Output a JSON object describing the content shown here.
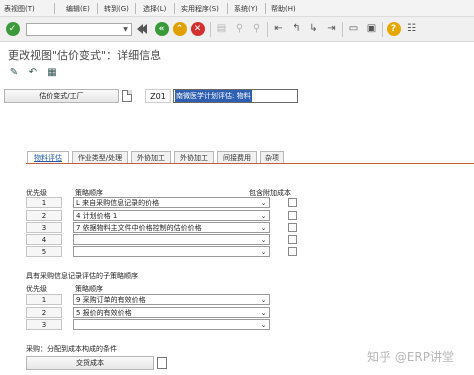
{
  "menu": [
    "表视图(T)",
    "编辑(E)",
    "转到(G)",
    "选择(L)",
    "实用程序(S)",
    "系统(Y)",
    "帮助(H)"
  ],
  "toolbar": {
    "command_value": "",
    "icons": [
      "check-icon",
      "dropdown-arrow",
      "save-icon",
      "back-icon",
      "exit-icon",
      "cancel-icon",
      "print-icon",
      "find-icon",
      "find-next-icon",
      "first-page-icon",
      "previous-page-icon",
      "next-page-icon",
      "last-page-icon",
      "new-session-icon",
      "shortcut-icon",
      "help-icon",
      "customize-icon"
    ]
  },
  "page_title": "更改视图\"估价变式\"：详细信息",
  "app_toolbar": [
    "display-change-icon",
    "undo-icon",
    "details-icon"
  ],
  "header": {
    "field_label": "估价变式/工厂",
    "code": "Z01",
    "description": "南微医学计划评估: 物料"
  },
  "tabs": [
    "物料评估",
    "作业类型/处理",
    "外协加工",
    "外协加工",
    "间接费用",
    "杂项"
  ],
  "strategy": {
    "col_priority": "优先级",
    "col_strategy": "策略顺序",
    "col_add_cost": "包含附加成本",
    "rows": [
      {
        "num": "1",
        "value": "L 来自采购信息记录的价格"
      },
      {
        "num": "2",
        "value": "4 计划价格 1"
      },
      {
        "num": "3",
        "value": "7 依据物料主文件中价格控制的估价价格"
      },
      {
        "num": "4",
        "value": ""
      },
      {
        "num": "5",
        "value": ""
      }
    ]
  },
  "sub_strategy": {
    "heading": "具有采购信息记录评估的子策略顺序",
    "col_priority": "优先级",
    "col_strategy": "策略顺序",
    "rows": [
      {
        "num": "1",
        "value": "9 采购订单的有效价格"
      },
      {
        "num": "2",
        "value": "5 报价的有效价格"
      },
      {
        "num": "3",
        "value": ""
      }
    ]
  },
  "purchasing": {
    "heading": "采购：分配到成本构成的条件",
    "button": "交货成本"
  },
  "watermark": "知乎 @ERP讲堂"
}
